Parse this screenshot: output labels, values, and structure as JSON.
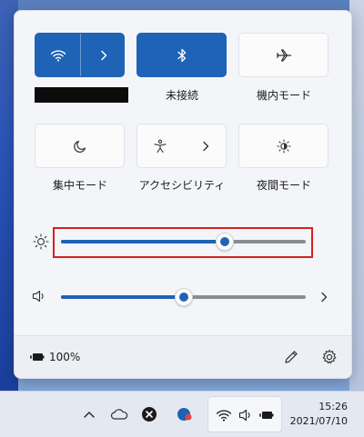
{
  "quick_settings": {
    "tiles": [
      {
        "id": "wifi",
        "label": "",
        "active": true,
        "label_redacted": true
      },
      {
        "id": "bluetooth",
        "label": "未接続",
        "active": true
      },
      {
        "id": "airplane",
        "label": "機内モード",
        "active": false
      },
      {
        "id": "focus",
        "label": "集中モード",
        "active": false
      },
      {
        "id": "accessibility",
        "label": "アクセシビリティ",
        "active": false
      },
      {
        "id": "night_light",
        "label": "夜間モード",
        "active": false
      }
    ],
    "brightness": {
      "value": 0.67
    },
    "volume": {
      "value": 0.5
    },
    "battery": {
      "percent_text": "100%"
    }
  },
  "taskbar": {
    "clock": {
      "time": "15:26",
      "date": "2021/07/10"
    }
  },
  "colors": {
    "accent": "#1e63b5",
    "highlight": "#d62020"
  }
}
